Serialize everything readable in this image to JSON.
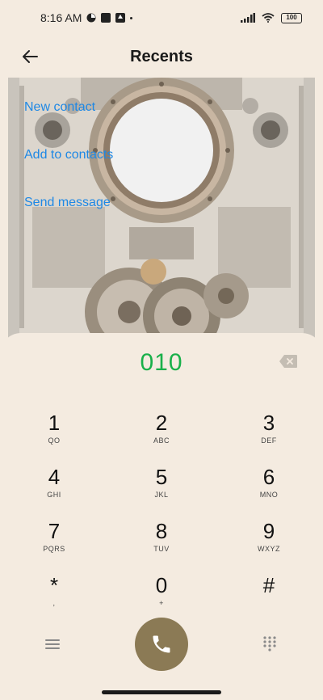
{
  "status_bar": {
    "time": "8:16 AM",
    "battery": "100"
  },
  "header": {
    "title": "Recents"
  },
  "actions": {
    "new_contact": "New contact",
    "add_to_contacts": "Add to contacts",
    "send_message": "Send message"
  },
  "dialer": {
    "number": "010",
    "keys": [
      {
        "digit": "1",
        "letters": "QO"
      },
      {
        "digit": "2",
        "letters": "ABC"
      },
      {
        "digit": "3",
        "letters": "DEF"
      },
      {
        "digit": "4",
        "letters": "GHI"
      },
      {
        "digit": "5",
        "letters": "JKL"
      },
      {
        "digit": "6",
        "letters": "MNO"
      },
      {
        "digit": "7",
        "letters": "PQRS"
      },
      {
        "digit": "8",
        "letters": "TUV"
      },
      {
        "digit": "9",
        "letters": "WXYZ"
      },
      {
        "digit": "*",
        "letters": ","
      },
      {
        "digit": "0",
        "letters": "+"
      },
      {
        "digit": "#",
        "letters": ""
      }
    ]
  },
  "colors": {
    "accent_green": "#19b04a",
    "link_blue": "#1e88e5",
    "call_button": "#8b7a55",
    "background": "#f4ebe0"
  },
  "icons": [
    "back-arrow-icon",
    "backspace-icon",
    "menu-icon",
    "phone-icon",
    "keypad-icon",
    "wifi-icon",
    "signal-icon",
    "battery-icon"
  ]
}
